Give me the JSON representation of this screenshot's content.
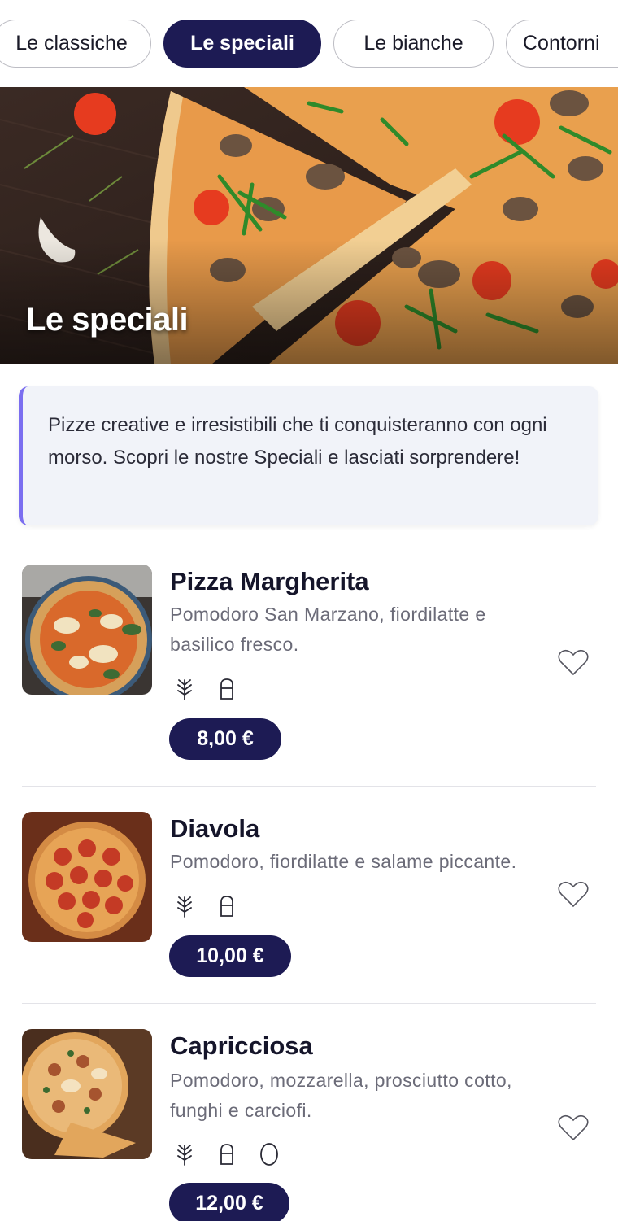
{
  "tabs": [
    {
      "label": "Le classiche",
      "active": false
    },
    {
      "label": "Le speciali",
      "active": true
    },
    {
      "label": "Le bianche",
      "active": false
    },
    {
      "label": "Contorni",
      "active": false
    }
  ],
  "hero": {
    "title": "Le speciali"
  },
  "description": "Pizze creative e irresistibili che ti conquisteranno con ogni morso. Scopri le nostre Speciali e lasciati sorprendere!",
  "items": [
    {
      "name": "Pizza Margherita",
      "description": "Pomodoro San Marzano, fiordilatte e basilico fresco.",
      "allergens": [
        "gluten-icon",
        "milk-icon"
      ],
      "price": "8,00 €"
    },
    {
      "name": "Diavola",
      "description": "Pomodoro, fiordilatte e salame piccante.",
      "allergens": [
        "gluten-icon",
        "milk-icon"
      ],
      "price": "10,00 €"
    },
    {
      "name": "Capricciosa",
      "description": "Pomodoro, mozzarella, prosciutto cotto, funghi e carciofi.",
      "allergens": [
        "gluten-icon",
        "milk-icon",
        "egg-icon"
      ],
      "price": "12,00 €"
    }
  ],
  "colors": {
    "accent": "#1d1b54",
    "border_accent": "#7b6ef0",
    "background": "#ffffff"
  }
}
